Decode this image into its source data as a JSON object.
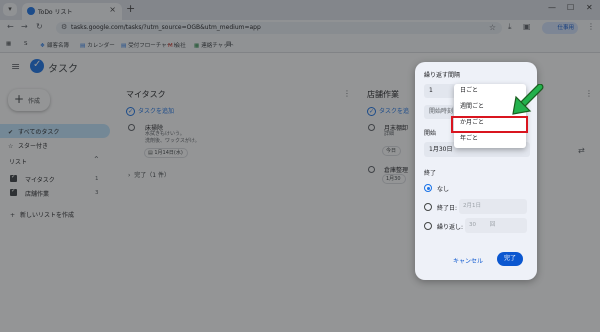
{
  "browser": {
    "tab_title": "ToDo リスト",
    "url": "tasks.google.com/tasks/?utm_source=OGB&utm_medium=app",
    "profile_label": "仕事用",
    "bookmarks": [
      "顧客名簿",
      "カレンダー",
      "受付フローチャート",
      "会社",
      "連絡チャット"
    ]
  },
  "app": {
    "title": "タスク",
    "create_label": "作成",
    "nav": {
      "all_tasks": "すべてのタスク",
      "starred": "スター付き",
      "lists_header": "リスト",
      "lists": [
        {
          "name": "マイタスク",
          "count": "1"
        },
        {
          "name": "店舗作業",
          "count": "3"
        }
      ],
      "new_list": "新しいリストを作成"
    }
  },
  "lists": {
    "mytasks": {
      "title": "マイタスク",
      "add_task": "タスクを追加",
      "task_title": "床掃除",
      "task_notes": [
        "水拭きもけいう。",
        "洗剤後、ワックスがけ。"
      ],
      "task_date": "1月14日(水)",
      "completed": "完了（1 件）"
    },
    "store": {
      "title": "店舗作業",
      "add_task": "タスクを追",
      "task1_title": "月末棚卸",
      "task1_note": "詳細",
      "task1_chip": "今日",
      "task2_title": "倉庫整理",
      "task2_date": "1月30"
    }
  },
  "dialog": {
    "title": "繰り返す間隔",
    "interval_value": "1",
    "start_time_label": "開始時刻",
    "start_label": "開始",
    "start_date": "1月30日",
    "end_label": "終了",
    "end_none": "なし",
    "end_on_label": "終了日:",
    "end_on_date": "2月1日",
    "end_after_label": "繰り返し:",
    "end_after_value": "30",
    "end_after_unit": "回",
    "cancel": "キャンセル",
    "done": "完了"
  },
  "dropdown": {
    "options": [
      "日ごと",
      "週間ごと",
      "か月ごと",
      "年ごと"
    ],
    "highlighted": "か月ごと"
  },
  "colors": {
    "accent": "#1a73e8",
    "annotation_red": "#d9151f",
    "annotation_arrow": "#22b14c"
  }
}
